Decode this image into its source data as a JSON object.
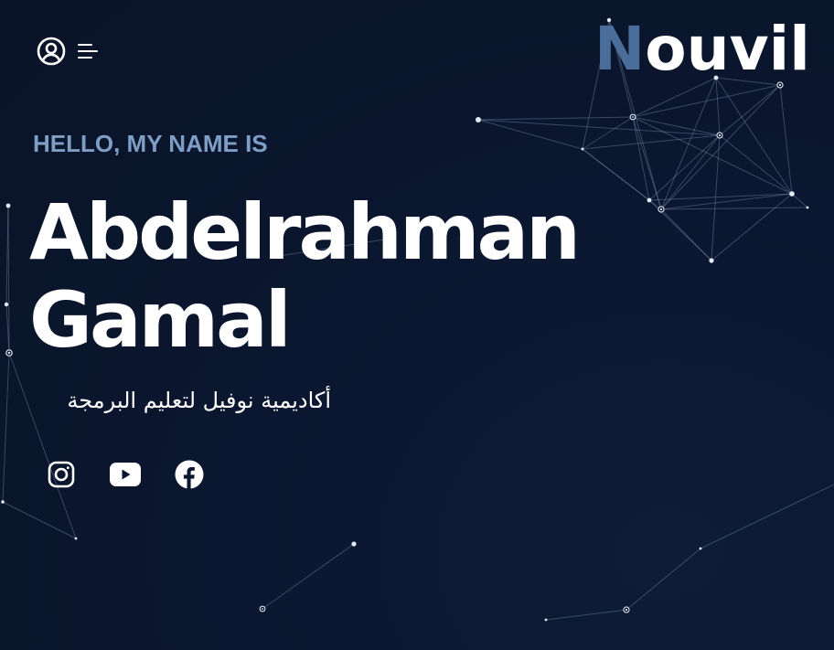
{
  "header": {
    "account_icon": "user-circle-icon",
    "menu_icon": "menu-lines-icon"
  },
  "logo": {
    "first_letter": "N",
    "rest": "ouvil",
    "first_letter_color": "#4b6d99",
    "rest_color": "#ffffff"
  },
  "hero": {
    "greeting": "HELLO, MY NAME IS",
    "name_line1": "Abdelrahman",
    "name_line2": "Gamal",
    "subtitle": "أكاديمية نوفيل لتعليم البرمجة"
  },
  "social": [
    {
      "name": "instagram",
      "icon": "instagram-icon"
    },
    {
      "name": "youtube",
      "icon": "youtube-icon"
    },
    {
      "name": "facebook",
      "icon": "facebook-icon"
    }
  ],
  "colors": {
    "background": "#0b1730",
    "accent": "#7f9ec6",
    "text": "#ffffff"
  }
}
